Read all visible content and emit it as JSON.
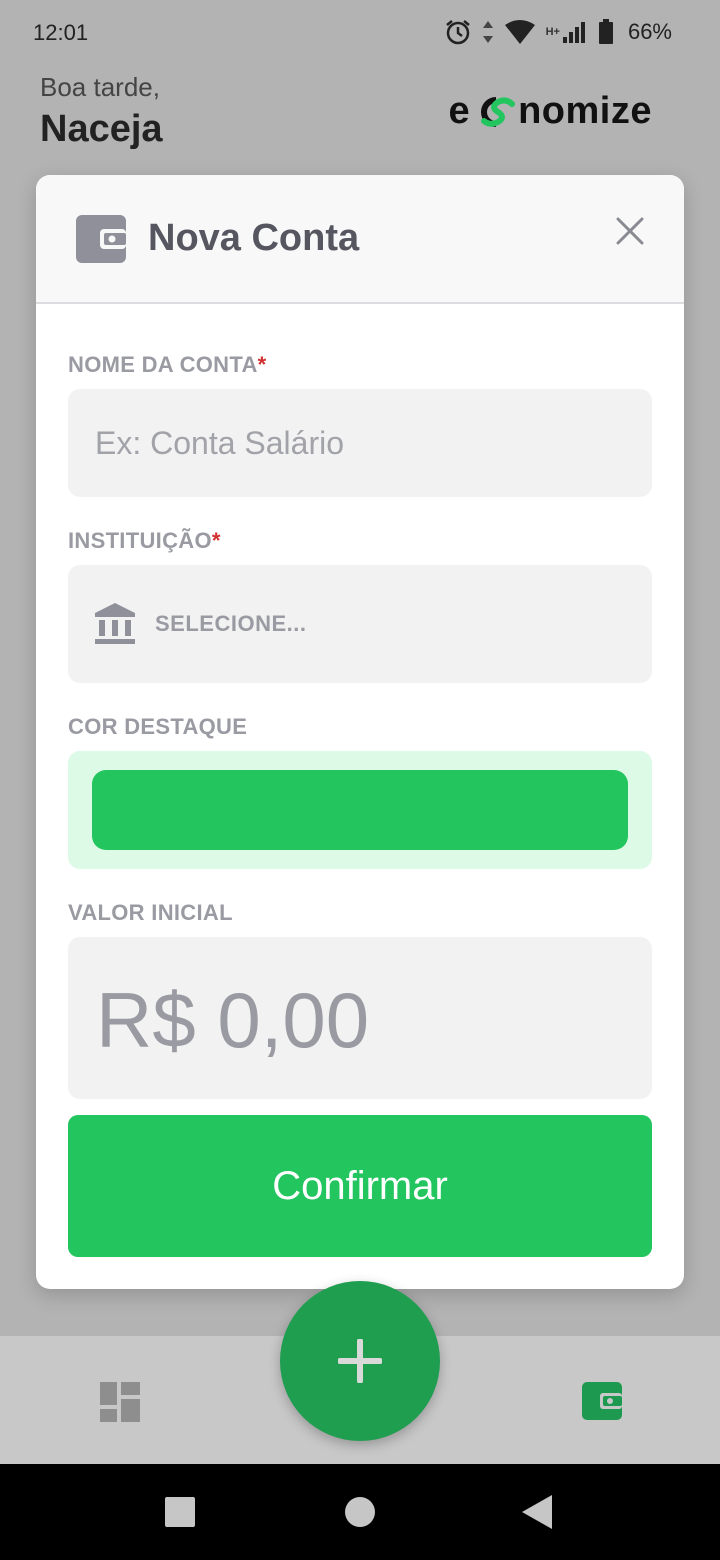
{
  "status_bar": {
    "time": "12:01",
    "network": "H+",
    "battery": "66%",
    "icons": [
      "alarm-icon",
      "data-arrows-icon",
      "wifi-icon",
      "signal-icon",
      "battery-icon"
    ]
  },
  "header": {
    "greeting": "Boa tarde,",
    "user_name": "Naceja",
    "logo_prefix": "e",
    "logo_suffix": "nomize"
  },
  "modal": {
    "title": "Nova Conta",
    "icon": "wallet-icon",
    "close_icon": "close-icon",
    "fields": {
      "account_name": {
        "label": "NOME DA CONTA",
        "required_mark": "*",
        "placeholder": "Ex: Conta Salário",
        "value": ""
      },
      "institution": {
        "label": "INSTITUIÇÃO",
        "required_mark": "*",
        "icon": "bank-icon",
        "placeholder": "SELECIONE..."
      },
      "highlight_color": {
        "label": "COR DESTAQUE",
        "value": "#22c55e",
        "background": "#dcfae6"
      },
      "initial_value": {
        "label": "VALOR INICIAL",
        "value": "R$ 0,00"
      }
    },
    "confirm_label": "Confirmar"
  },
  "bottom_nav": {
    "left_icon": "dashboard-icon",
    "fab_icon": "plus-icon",
    "right_icon": "wallet-icon"
  },
  "colors": {
    "brand_green": "#22c55e",
    "fab_green": "#1f9e50",
    "nav_active": "#1e9950",
    "nav_inactive": "#8e8e8e"
  }
}
